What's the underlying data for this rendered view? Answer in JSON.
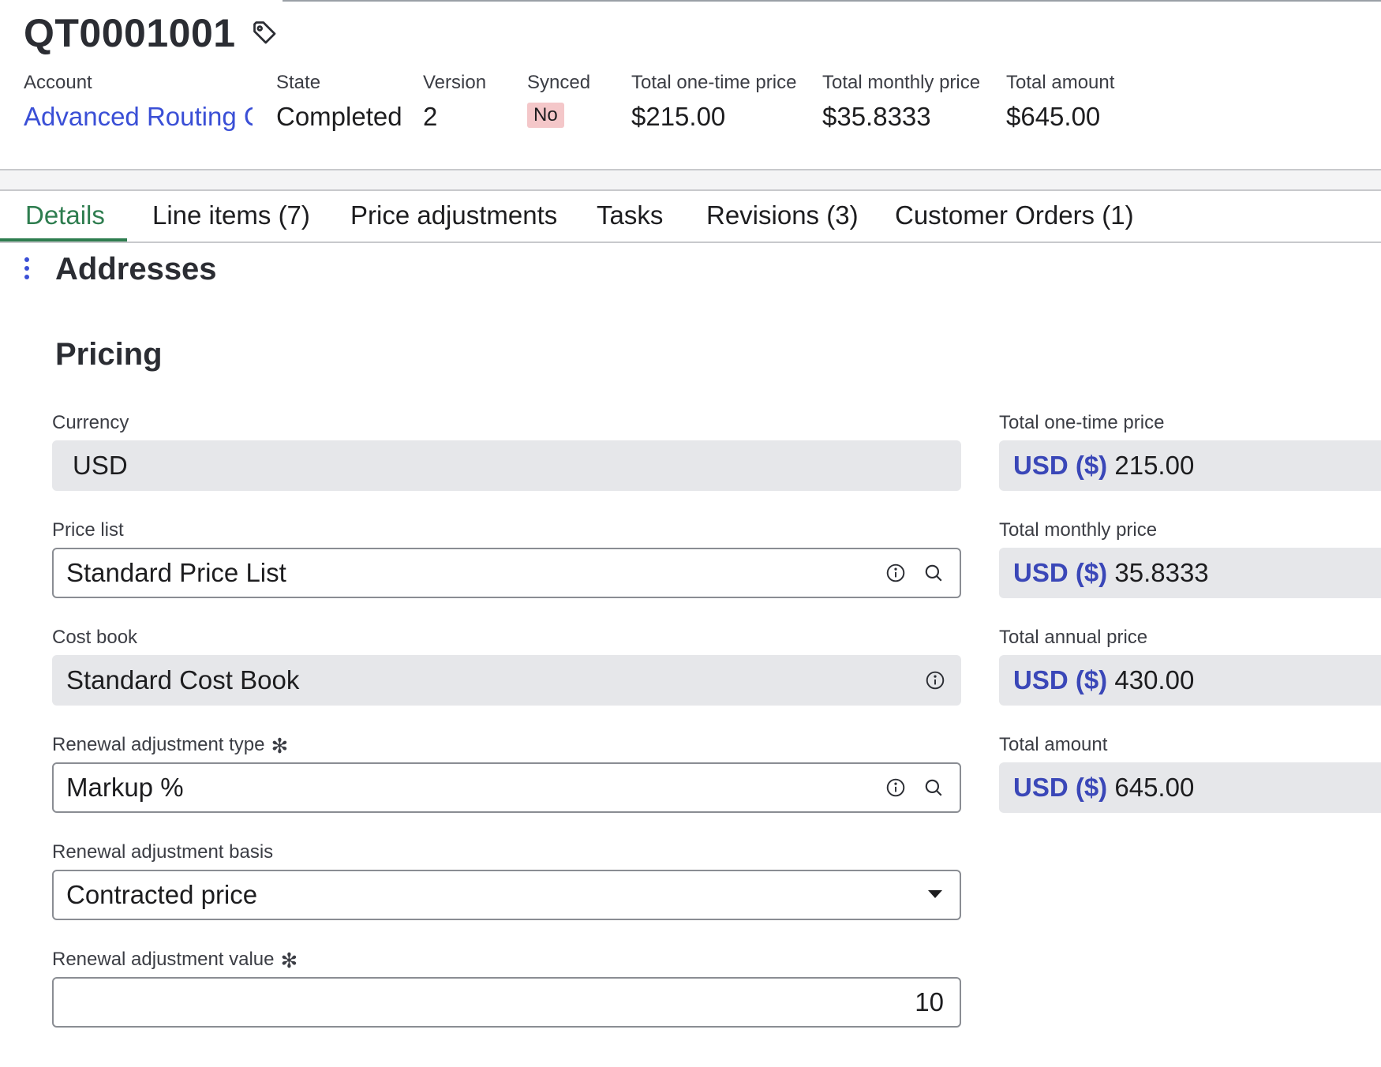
{
  "header": {
    "record_id": "QT0001001",
    "fields": [
      {
        "label": "Account",
        "value": "Advanced Routing Co"
      },
      {
        "label": "State",
        "value": "Completed"
      },
      {
        "label": "Version",
        "value": "2"
      },
      {
        "label": "Synced",
        "value": "No"
      },
      {
        "label": "Total one-time price",
        "value": "$215.00"
      },
      {
        "label": "Total monthly price",
        "value": "$35.8333"
      },
      {
        "label": "Total amount",
        "value": "$645.00"
      }
    ]
  },
  "tabs": [
    {
      "label": "Details",
      "active": true
    },
    {
      "label": "Line items (7)",
      "active": false
    },
    {
      "label": "Price adjustments",
      "active": false
    },
    {
      "label": "Tasks",
      "active": false
    },
    {
      "label": "Revisions (3)",
      "active": false
    },
    {
      "label": "Customer Orders (1)",
      "active": false
    }
  ],
  "sections": {
    "addresses_title": "Addresses",
    "pricing_title": "Pricing"
  },
  "pricing": {
    "currency": {
      "label": "Currency",
      "value": "USD"
    },
    "price_list": {
      "label": "Price list",
      "value": "Standard Price List"
    },
    "cost_book": {
      "label": "Cost book",
      "value": "Standard Cost Book"
    },
    "renewal_type": {
      "label": "Renewal adjustment type",
      "value": "Markup %",
      "required_mark": "✻"
    },
    "renewal_basis": {
      "label": "Renewal adjustment basis",
      "value": "Contracted price"
    },
    "renewal_value": {
      "label": "Renewal adjustment value",
      "value": "10",
      "required_mark": "✻"
    },
    "totals": [
      {
        "label": "Total one-time price",
        "currency": "USD ($)",
        "value": "215.00"
      },
      {
        "label": "Total monthly price",
        "currency": "USD ($)",
        "value": "35.8333"
      },
      {
        "label": "Total annual price",
        "currency": "USD ($)",
        "value": "430.00"
      },
      {
        "label": "Total amount",
        "currency": "USD ($)",
        "value": "645.00"
      }
    ]
  },
  "colors": {
    "accent_link": "#3a4fd6",
    "active_tab": "#2e7d4f",
    "badge_no_bg": "#f4c7c9",
    "readonly_bg": "#e6e7ea"
  },
  "icons": {
    "tag": "tag-icon",
    "info": "info-icon",
    "search": "search-icon",
    "more": "kebab-icon",
    "dropdown": "chevron-down-icon"
  }
}
